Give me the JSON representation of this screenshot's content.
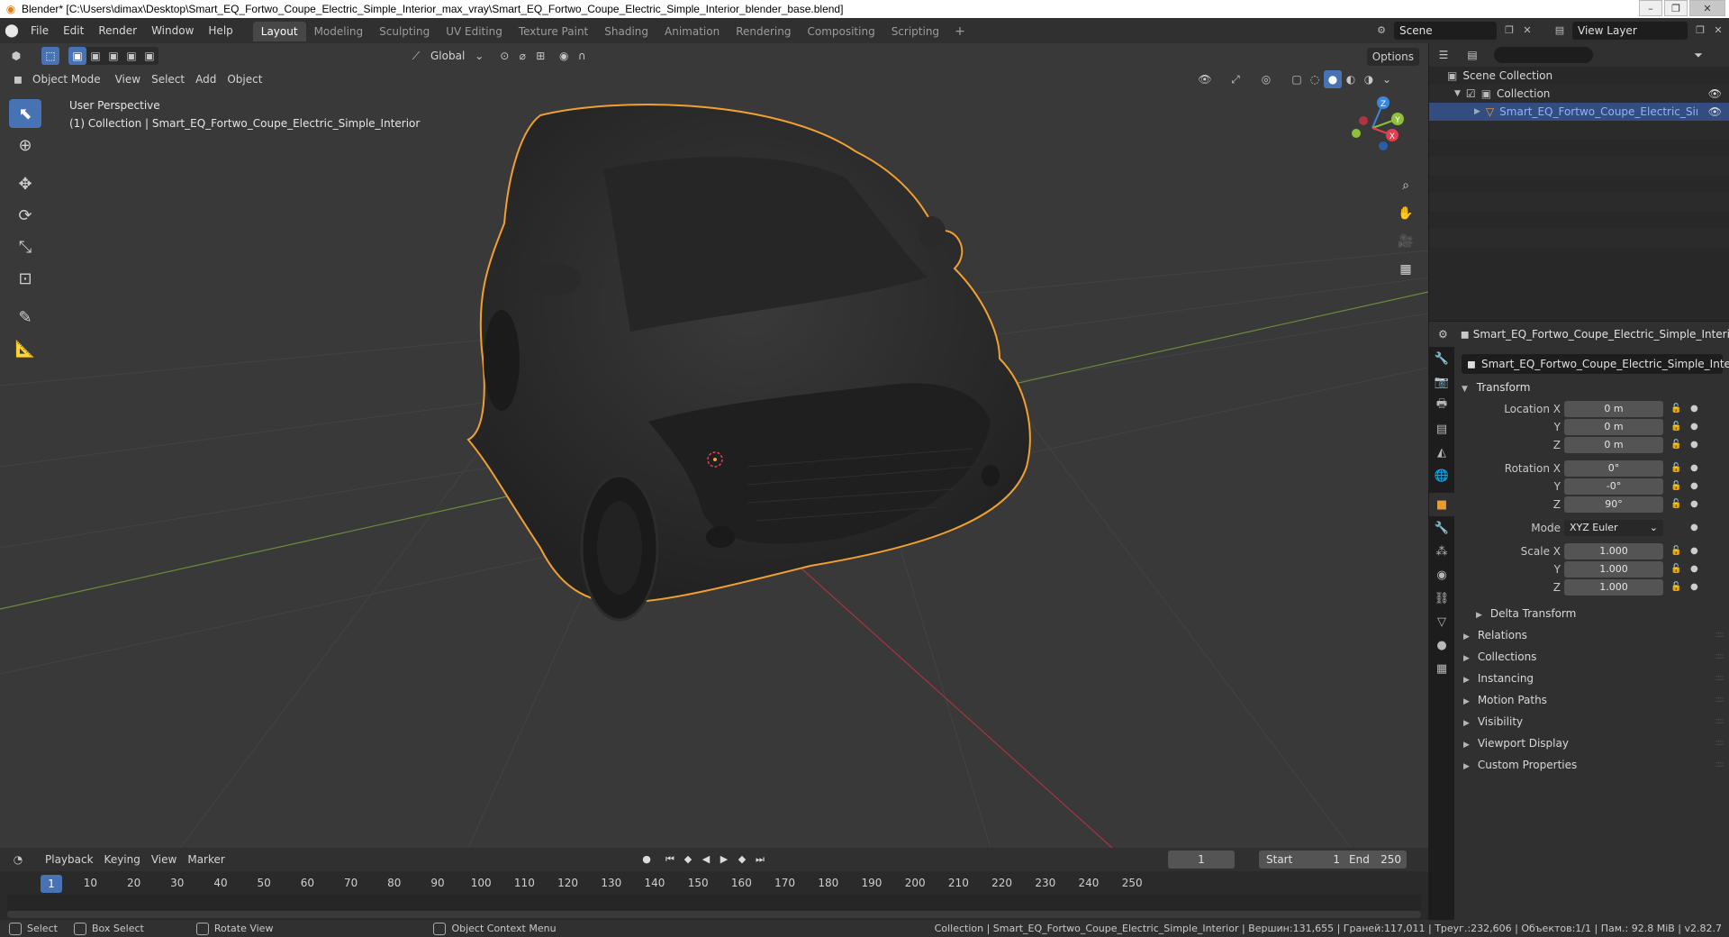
{
  "window": {
    "title": "Blender* [C:\\Users\\dimax\\Desktop\\Smart_EQ_Fortwo_Coupe_Electric_Simple_Interior_max_vray\\Smart_EQ_Fortwo_Coupe_Electric_Simple_Interior_blender_base.blend]"
  },
  "menu": [
    "File",
    "Edit",
    "Render",
    "Window",
    "Help"
  ],
  "tabs": [
    "Layout",
    "Modeling",
    "Sculpting",
    "UV Editing",
    "Texture Paint",
    "Shading",
    "Animation",
    "Rendering",
    "Compositing",
    "Scripting"
  ],
  "active_tab": "Layout",
  "scene": {
    "name": "Scene",
    "view_layer": "View Layer"
  },
  "viewport": {
    "mode": "Object Mode",
    "menus": [
      "View",
      "Select",
      "Add",
      "Object"
    ],
    "transform_orientation": "Global",
    "options_label": "Options",
    "perspective_label": "User Perspective",
    "collection_label": "(1) Collection | Smart_EQ_Fortwo_Coupe_Electric_Simple_Interior",
    "gizmo_axes": [
      "Z",
      "Y",
      "X"
    ]
  },
  "outliner": {
    "search_placeholder": "",
    "scene_collection": "Scene Collection",
    "collection": "Collection",
    "object": "Smart_EQ_Fortwo_Coupe_Electric_Simple_Interior"
  },
  "properties": {
    "header_object": "Smart_EQ_Fortwo_Coupe_Electric_Simple_Interior",
    "object_name": "Smart_EQ_Fortwo_Coupe_Electric_Simple_Inter...",
    "transform_title": "Transform",
    "location": {
      "label": "Location X",
      "x": "0 m",
      "y": "0 m",
      "z": "0 m"
    },
    "rotation": {
      "label": "Rotation X",
      "x": "0°",
      "y": "-0°",
      "z": "90°"
    },
    "mode": {
      "label": "Mode",
      "value": "XYZ Euler"
    },
    "scale": {
      "label": "Scale X",
      "x": "1.000",
      "y": "1.000",
      "z": "1.000"
    },
    "axis_y": "Y",
    "axis_z": "Z",
    "delta_transform": "Delta Transform",
    "panels": [
      "Relations",
      "Collections",
      "Instancing",
      "Motion Paths",
      "Visibility",
      "Viewport Display",
      "Custom Properties"
    ]
  },
  "timeline": {
    "menus": [
      "Playback",
      "Keying",
      "View",
      "Marker"
    ],
    "current_frame": "1",
    "start_label": "Start",
    "start": "1",
    "end_label": "End",
    "end": "250",
    "ticks": [
      "10",
      "20",
      "30",
      "40",
      "50",
      "60",
      "70",
      "80",
      "90",
      "100",
      "110",
      "120",
      "130",
      "140",
      "150",
      "160",
      "170",
      "180",
      "190",
      "200",
      "210",
      "220",
      "230",
      "240",
      "250"
    ]
  },
  "statusbar": {
    "select": "Select",
    "box_select": "Box Select",
    "rotate_view": "Rotate View",
    "context_menu": "Object Context Menu",
    "stats": "Collection | Smart_EQ_Fortwo_Coupe_Electric_Simple_Interior | Вершин:131,655 | Граней:117,011 | Треуг.:232,606 | Объектов:1/1 | Пам.: 92.8 MiB | v2.82.7"
  },
  "colors": {
    "accent_blue": "#4772b3",
    "selection_orange": "#f0a030",
    "x_axis": "#e04050",
    "y_axis": "#8fc03a",
    "z_axis": "#3a86e0"
  }
}
